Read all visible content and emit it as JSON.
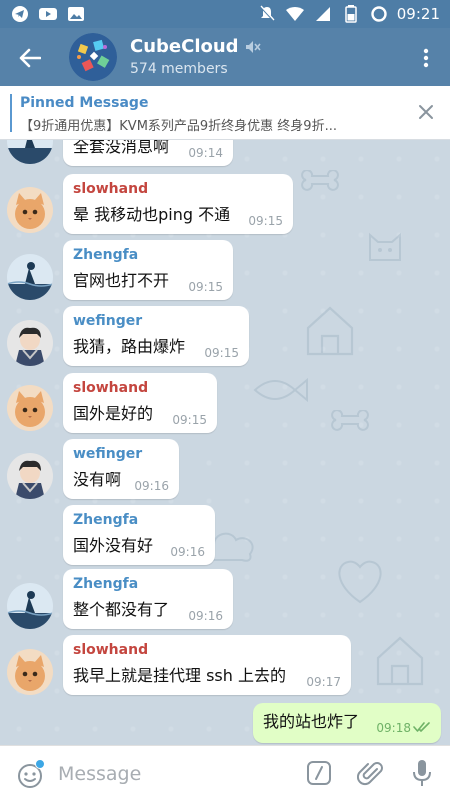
{
  "status_bar": {
    "time": "09:21"
  },
  "header": {
    "title": "CubeCloud",
    "subtitle": "574 members"
  },
  "pinned": {
    "title": "Pinned Message",
    "text": "【9折通用优惠】KVM系列产品9折终身优惠 终身9折..."
  },
  "messages": [
    {
      "sender": "",
      "text": "全套没消息啊",
      "time": "09:14"
    },
    {
      "sender": "slowhand",
      "text": "晕 我移动也ping 不通",
      "time": "09:15"
    },
    {
      "sender": "Zhengfa",
      "text": "官网也打不开",
      "time": "09:15"
    },
    {
      "sender": "wefinger",
      "text": "我猜，路由爆炸",
      "time": "09:15"
    },
    {
      "sender": "slowhand",
      "text": "国外是好的",
      "time": "09:15"
    },
    {
      "sender": "wefinger",
      "text": "没有啊",
      "time": "09:16"
    },
    {
      "sender": "Zhengfa",
      "text": "国外没有好",
      "time": "09:16"
    },
    {
      "sender": "Zhengfa",
      "text": "整个都没有了",
      "time": "09:16"
    },
    {
      "sender": "slowhand",
      "text": "我早上就是挂代理 ssh 上去的",
      "time": "09:17"
    }
  ],
  "outgoing": {
    "text": "我的站也炸了",
    "time": "09:18"
  },
  "composer": {
    "placeholder": "Message"
  },
  "colors": {
    "header": "#5682a9",
    "statusbar": "#4e7da6",
    "name_red": "#c4463f",
    "name_blue": "#4a8ec5",
    "outgoing_bubble": "#e1fec6"
  }
}
